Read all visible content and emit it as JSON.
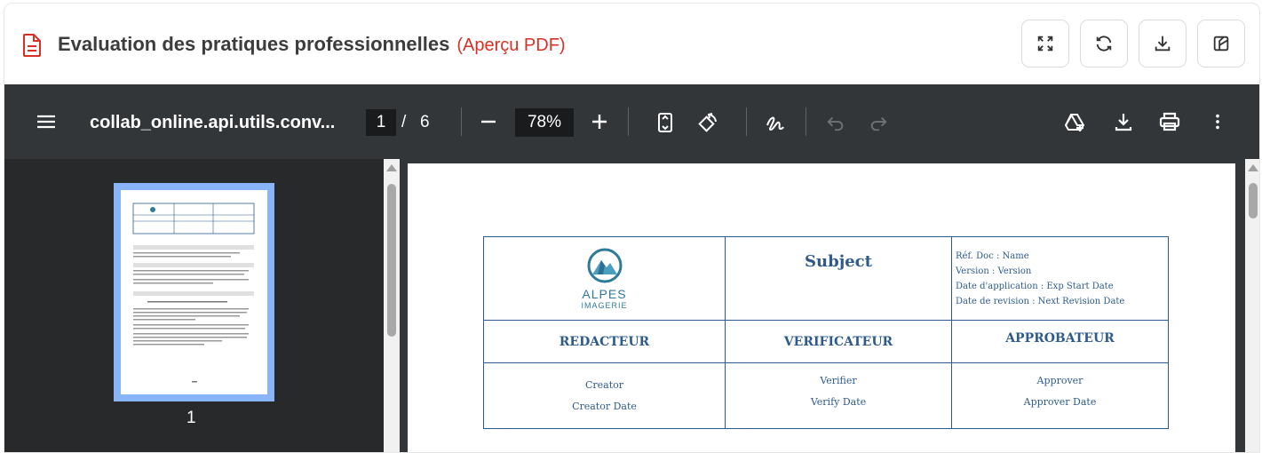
{
  "header": {
    "title": "Evaluation des pratiques professionnelles",
    "subtitle": "(Aperçu PDF)",
    "buttons": [
      "fullscreen-icon",
      "refresh-icon",
      "download-icon",
      "theme-icon"
    ]
  },
  "viewer": {
    "filename": "collab_online.api.utils.conv...",
    "current_page": "1",
    "page_separator": "/",
    "total_pages": "6",
    "zoom": "78%",
    "thumbnail_label": "1"
  },
  "document": {
    "logo": {
      "line1": "ALPES",
      "line2": "IMAGERIE"
    },
    "subject": "Subject",
    "meta": [
      "Réf. Doc :  Name",
      "Version :  Version",
      "Date d'application :  Exp Start Date",
      "Date de revision :  Next Revision Date"
    ],
    "roles": [
      "REDACTEUR",
      "VERIFICATEUR",
      "APPROBATEUR"
    ],
    "redacteur": [
      "Creator",
      "Creator Date"
    ],
    "verificateur": [
      "Verifier",
      "Verify Date"
    ],
    "approbateur": [
      "Approver",
      "Approver Date"
    ]
  },
  "colors": {
    "accent_red": "#d93025",
    "viewer_bg": "#323639",
    "doc_blue": "#2e5b8c",
    "thumb_border": "#8ab4f8"
  }
}
